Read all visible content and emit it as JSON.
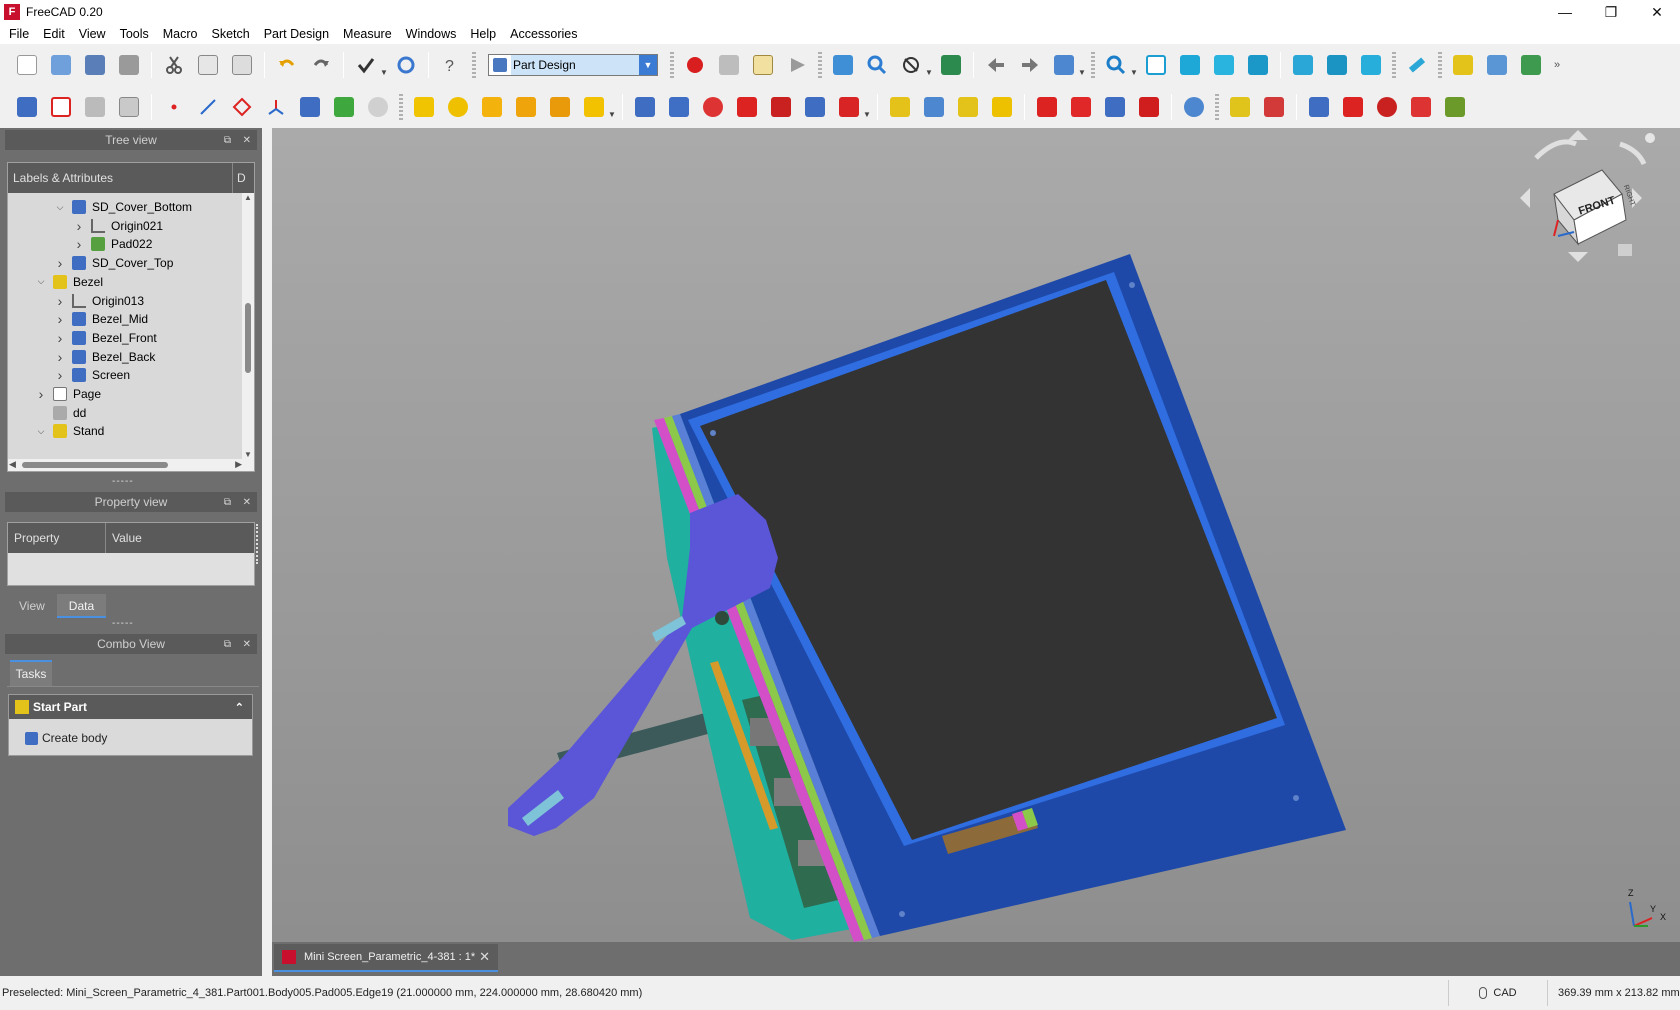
{
  "window": {
    "title": "FreeCAD 0.20"
  },
  "menu": [
    "File",
    "Edit",
    "View",
    "Tools",
    "Macro",
    "Sketch",
    "Part Design",
    "Measure",
    "Windows",
    "Help",
    "Accessories"
  ],
  "workbench": {
    "selected": "Part Design"
  },
  "tree_view": {
    "title": "Tree view",
    "columns": [
      "Labels & Attributes",
      "D"
    ],
    "items": [
      {
        "label": "SD_Cover_Bottom",
        "icon": "body-icon",
        "depth": 2,
        "expander": "expanded"
      },
      {
        "label": "Origin021",
        "icon": "origin-icon",
        "depth": 3,
        "expander": "collapsed"
      },
      {
        "label": "Pad022",
        "icon": "pad-icon",
        "depth": 3,
        "expander": "collapsed"
      },
      {
        "label": "SD_Cover_Top",
        "icon": "body-icon",
        "depth": 2,
        "expander": "collapsed"
      },
      {
        "label": "Bezel",
        "icon": "part-icon",
        "depth": 1,
        "expander": "expanded"
      },
      {
        "label": "Origin013",
        "icon": "origin-icon",
        "depth": 2,
        "expander": "collapsed"
      },
      {
        "label": "Bezel_Mid",
        "icon": "body-icon",
        "depth": 2,
        "expander": "collapsed"
      },
      {
        "label": "Bezel_Front",
        "icon": "body-icon",
        "depth": 2,
        "expander": "collapsed"
      },
      {
        "label": "Bezel_Back",
        "icon": "body-icon",
        "depth": 2,
        "expander": "collapsed"
      },
      {
        "label": "Screen",
        "icon": "body-icon",
        "depth": 2,
        "expander": "collapsed"
      },
      {
        "label": "Page",
        "icon": "page-icon",
        "depth": 1,
        "expander": "collapsed"
      },
      {
        "label": "dd",
        "icon": "spreadsheet-icon",
        "depth": 1,
        "expander": "none"
      },
      {
        "label": "Stand",
        "icon": "part-icon",
        "depth": 1,
        "expander": "expanded"
      }
    ]
  },
  "property_view": {
    "title": "Property view",
    "columns": [
      "Property",
      "Value"
    ],
    "tabs": [
      "View",
      "Data"
    ],
    "active_tab": "Data"
  },
  "combo_view": {
    "title": "Combo View",
    "tab": "Tasks",
    "task_panel": {
      "title": "Start Part",
      "action": "Create body"
    }
  },
  "view3d": {
    "navcube_face": "FRONT",
    "navcube_side": "RIGHT",
    "axis_labels": [
      "Z",
      "Y",
      "X"
    ],
    "background_top": "#aaaaaa",
    "background_bottom": "#8e8e8e"
  },
  "document_tab": {
    "label": "Mini Screen_Parametric_4-381 : 1*"
  },
  "status": {
    "message": "Preselected: Mini_Screen_Parametric_4_381.Part001.Body005.Pad005.Edge19 (21.000000 mm, 224.000000 mm, 28.680420 mm)",
    "nav_style": "CAD",
    "dimensions": "369.39 mm x 213.82 mm"
  },
  "colors": {
    "bezel_blue": "#1e49a8",
    "screen_dark": "#333333",
    "stand_purple": "#5b55d8",
    "teal_back": "#1fb0a0",
    "accent": "#4a90e2"
  }
}
